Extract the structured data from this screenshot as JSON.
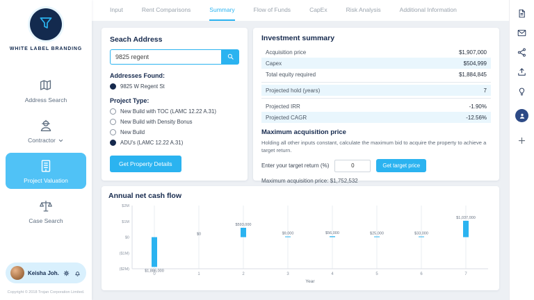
{
  "brand": {
    "name": "WHITE LABEL BRANDING"
  },
  "colors": {
    "accent": "#2bb3f0",
    "navy": "#15294d",
    "active_nav_bg": "#50c2f6",
    "row_stripe": "#e9f6fd"
  },
  "sidebar": {
    "items": [
      {
        "label": "Address Search",
        "icon": "map-search-icon",
        "active": false,
        "chevron": false
      },
      {
        "label": "Contractor",
        "icon": "contractor-icon",
        "active": false,
        "chevron": true
      },
      {
        "label": "Project Valuation",
        "icon": "building-valuation-icon",
        "active": true,
        "chevron": false
      },
      {
        "label": "Case Search",
        "icon": "case-search-icon",
        "active": false,
        "chevron": false
      }
    ],
    "user": {
      "name": "Keisha Joh."
    },
    "copyright": "Copyright © 2018 Trojan Corporation Limited."
  },
  "tabs": {
    "items": [
      "Input",
      "Rent Comparisons",
      "Summary",
      "Flow of Funds",
      "CapEx",
      "Risk Analysis",
      "Additional Information"
    ],
    "active": "Summary"
  },
  "right_toolbar": {
    "icons": [
      "document-icon",
      "mail-icon",
      "share-icon",
      "upload-icon",
      "lightbulb-icon",
      "user-avatar",
      "plus-icon"
    ]
  },
  "search_card": {
    "title": "Seach Address",
    "input_value": "9825 regent",
    "addresses_found_label": "Addresses Found:",
    "addresses": [
      {
        "label": "9825 W Regent St",
        "selected": true
      }
    ],
    "project_type_label": "Project Type:",
    "project_types": [
      {
        "label": "New Build with TOC (LAMC 12.22 A.31)",
        "selected": false
      },
      {
        "label": "New Build with Density Bonus",
        "selected": false
      },
      {
        "label": "New Build",
        "selected": false
      },
      {
        "label": "ADU's (LAMC 12.22 A.31)",
        "selected": true
      }
    ],
    "button_label": "Get Property Details"
  },
  "investment_summary": {
    "title": "Investment summary",
    "groups": [
      {
        "rows": [
          {
            "label": "Acquisition price",
            "value": "$1,907,000"
          },
          {
            "label": "Capex",
            "value": "$504,999"
          },
          {
            "label": "Total equity required",
            "value": "$1,884,845"
          }
        ]
      },
      {
        "rows": [
          {
            "label": "Projected hold (years)",
            "value": "7"
          }
        ]
      },
      {
        "rows": [
          {
            "label": "Projected IRR",
            "value": "-1.90%"
          },
          {
            "label": "Projected CAGR",
            "value": "-12.56%"
          }
        ]
      }
    ],
    "max_price": {
      "title": "Maximum acquisition price",
      "description": "Holding all other inputs constant, calculate the maximum bid to acquire the property to achieve a target return.",
      "input_label": "Enter your target return (%)",
      "input_value": "0",
      "button_label": "Get target price",
      "result": "Maximum acquisition price: $1,752,532"
    }
  },
  "chart_data": {
    "type": "bar",
    "title": "Annual net cash flow",
    "xlabel": "Year",
    "ylabel": "",
    "categories": [
      "0",
      "1",
      "2",
      "3",
      "4",
      "5",
      "6",
      "7"
    ],
    "values": [
      -1886000,
      0,
      593000,
      9000,
      56000,
      25000,
      33000,
      1037000
    ],
    "bar_labels": [
      "$1,886,000",
      "$0",
      "$593,000",
      "$9,000",
      "$56,000",
      "$25,000",
      "$33,000",
      "$1,037,000"
    ],
    "ytick_labels": [
      "$2M",
      "$1M",
      "$0",
      "($1M)",
      "($2M)"
    ],
    "ylim": [
      -2000000,
      2000000
    ],
    "bar_color": "#2bb3f0",
    "grid": "vertical",
    "legend": "none"
  }
}
